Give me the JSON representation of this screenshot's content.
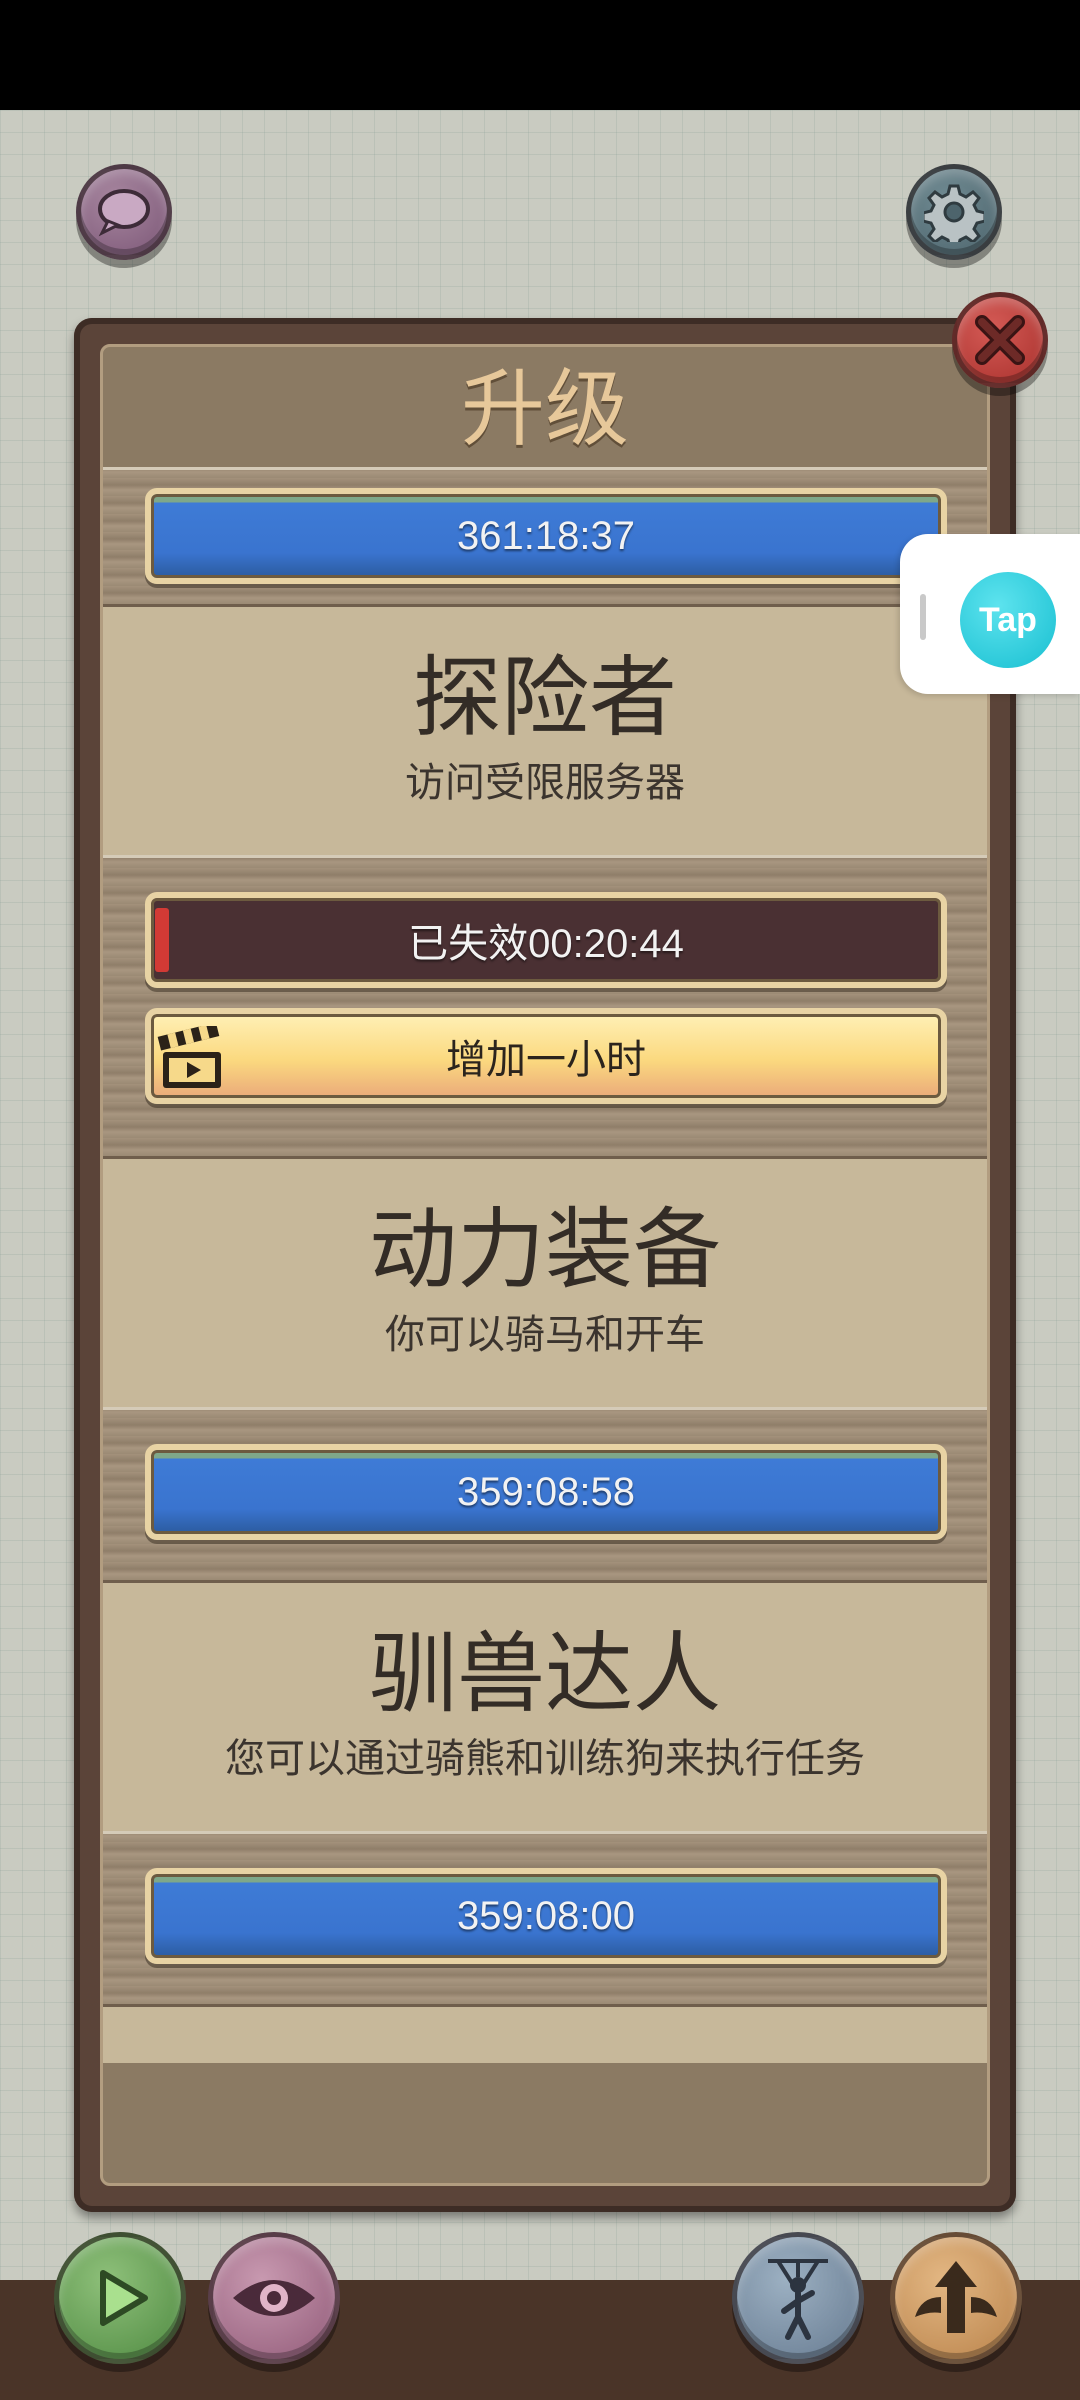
{
  "dialog": {
    "title": "升级"
  },
  "top_timer": "361:18:37",
  "upgrades": [
    {
      "name": "探险者",
      "description": "访问受限服务器",
      "status": "已失效00:20:44",
      "action_label": "增加一小时"
    },
    {
      "name": "动力装备",
      "description": "你可以骑马和开车",
      "timer": "359:08:58"
    },
    {
      "name": "驯兽达人",
      "description": "您可以通过骑熊和训练狗来执行任务",
      "timer": "359:08:00"
    },
    {
      "name": "",
      "description": ""
    }
  ],
  "overlay": {
    "tap_label": "Tap"
  },
  "colors": {
    "timer_bar": "#3e7bd6",
    "expired_bar": "#4a3033",
    "action_bar": "#fbd97f",
    "title_text": "#e7c89a"
  },
  "icons": [
    "chat-icon",
    "gear-icon",
    "close-icon",
    "clapperboard-icon",
    "play-icon",
    "eye-icon",
    "puppet-icon",
    "winged-arrow-icon"
  ]
}
